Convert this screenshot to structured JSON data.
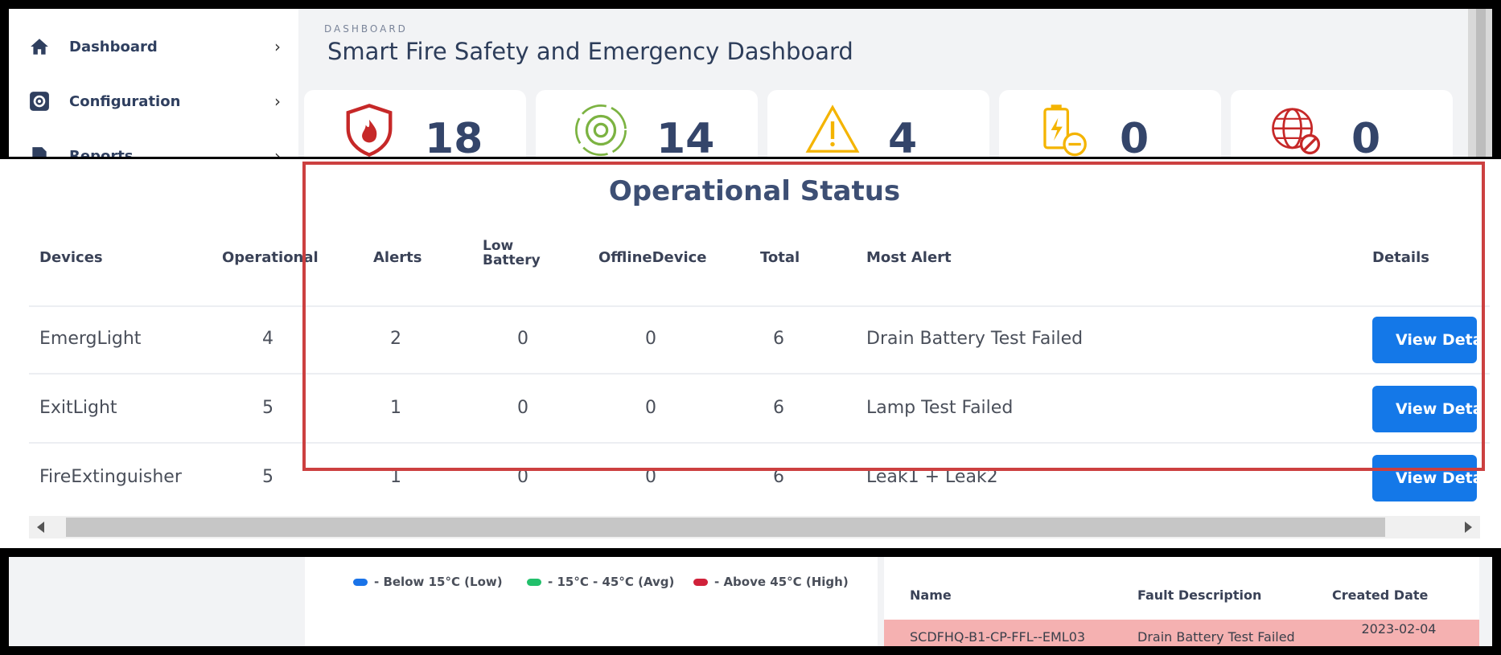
{
  "sidebar": {
    "items": [
      {
        "label": "Dashboard",
        "icon": "home-icon"
      },
      {
        "label": "Configuration",
        "icon": "gear-icon"
      },
      {
        "label": "Reports",
        "icon": "report-icon"
      }
    ]
  },
  "header": {
    "breadcrumb": "DASHBOARD",
    "title": "Smart Fire Safety and Emergency Dashboard"
  },
  "stats": [
    {
      "icon": "fire-shield-icon",
      "value": "18",
      "color": "#c62828"
    },
    {
      "icon": "gear-cycle-icon",
      "value": "14",
      "color": "#7cb342"
    },
    {
      "icon": "warning-icon",
      "value": "4",
      "color": "#f4b400"
    },
    {
      "icon": "low-battery-icon",
      "value": "0",
      "color": "#f4b400"
    },
    {
      "icon": "offline-globe-icon",
      "value": "0",
      "color": "#c62828"
    }
  ],
  "operational": {
    "title": "Operational Status",
    "columns": {
      "devices": "Devices",
      "operational": "Operational",
      "alerts": "Alerts",
      "low_battery_1": "Low",
      "low_battery_2": "Battery",
      "offline": "OfflineDevice",
      "total": "Total",
      "most_alert": "Most Alert",
      "details": "Details"
    },
    "rows": [
      {
        "device": "EmergLight",
        "operational": "4",
        "alerts": "2",
        "low_battery": "0",
        "offline": "0",
        "total": "6",
        "most_alert": "Drain Battery Test Failed",
        "action": "View Details"
      },
      {
        "device": "ExitLight",
        "operational": "5",
        "alerts": "1",
        "low_battery": "0",
        "offline": "0",
        "total": "6",
        "most_alert": "Lamp Test Failed",
        "action": "View Details"
      },
      {
        "device": "FireExtinguisher",
        "operational": "5",
        "alerts": "1",
        "low_battery": "0",
        "offline": "0",
        "total": "6",
        "most_alert": "Leak1 + Leak2",
        "action": "View Details"
      }
    ]
  },
  "temperature_legend": [
    {
      "label": "- Below 15°C (Low)",
      "color": "#1a73e8"
    },
    {
      "label": "- 15°C - 45°C (Avg)",
      "color": "#22c06b"
    },
    {
      "label": "- Above 45°C (High)",
      "color": "#d0213a"
    }
  ],
  "fault_table": {
    "columns": {
      "name": "Name",
      "description": "Fault Description",
      "created": "Created Date"
    },
    "rows": [
      {
        "name": "SCDFHQ-B1-CP-FFL--EML03",
        "description": "Drain Battery Test Failed",
        "created": "2023-02-04"
      }
    ]
  },
  "colors": {
    "accent": "#1478e8",
    "title": "#2d3d5a",
    "highlight": "#cc4040"
  }
}
